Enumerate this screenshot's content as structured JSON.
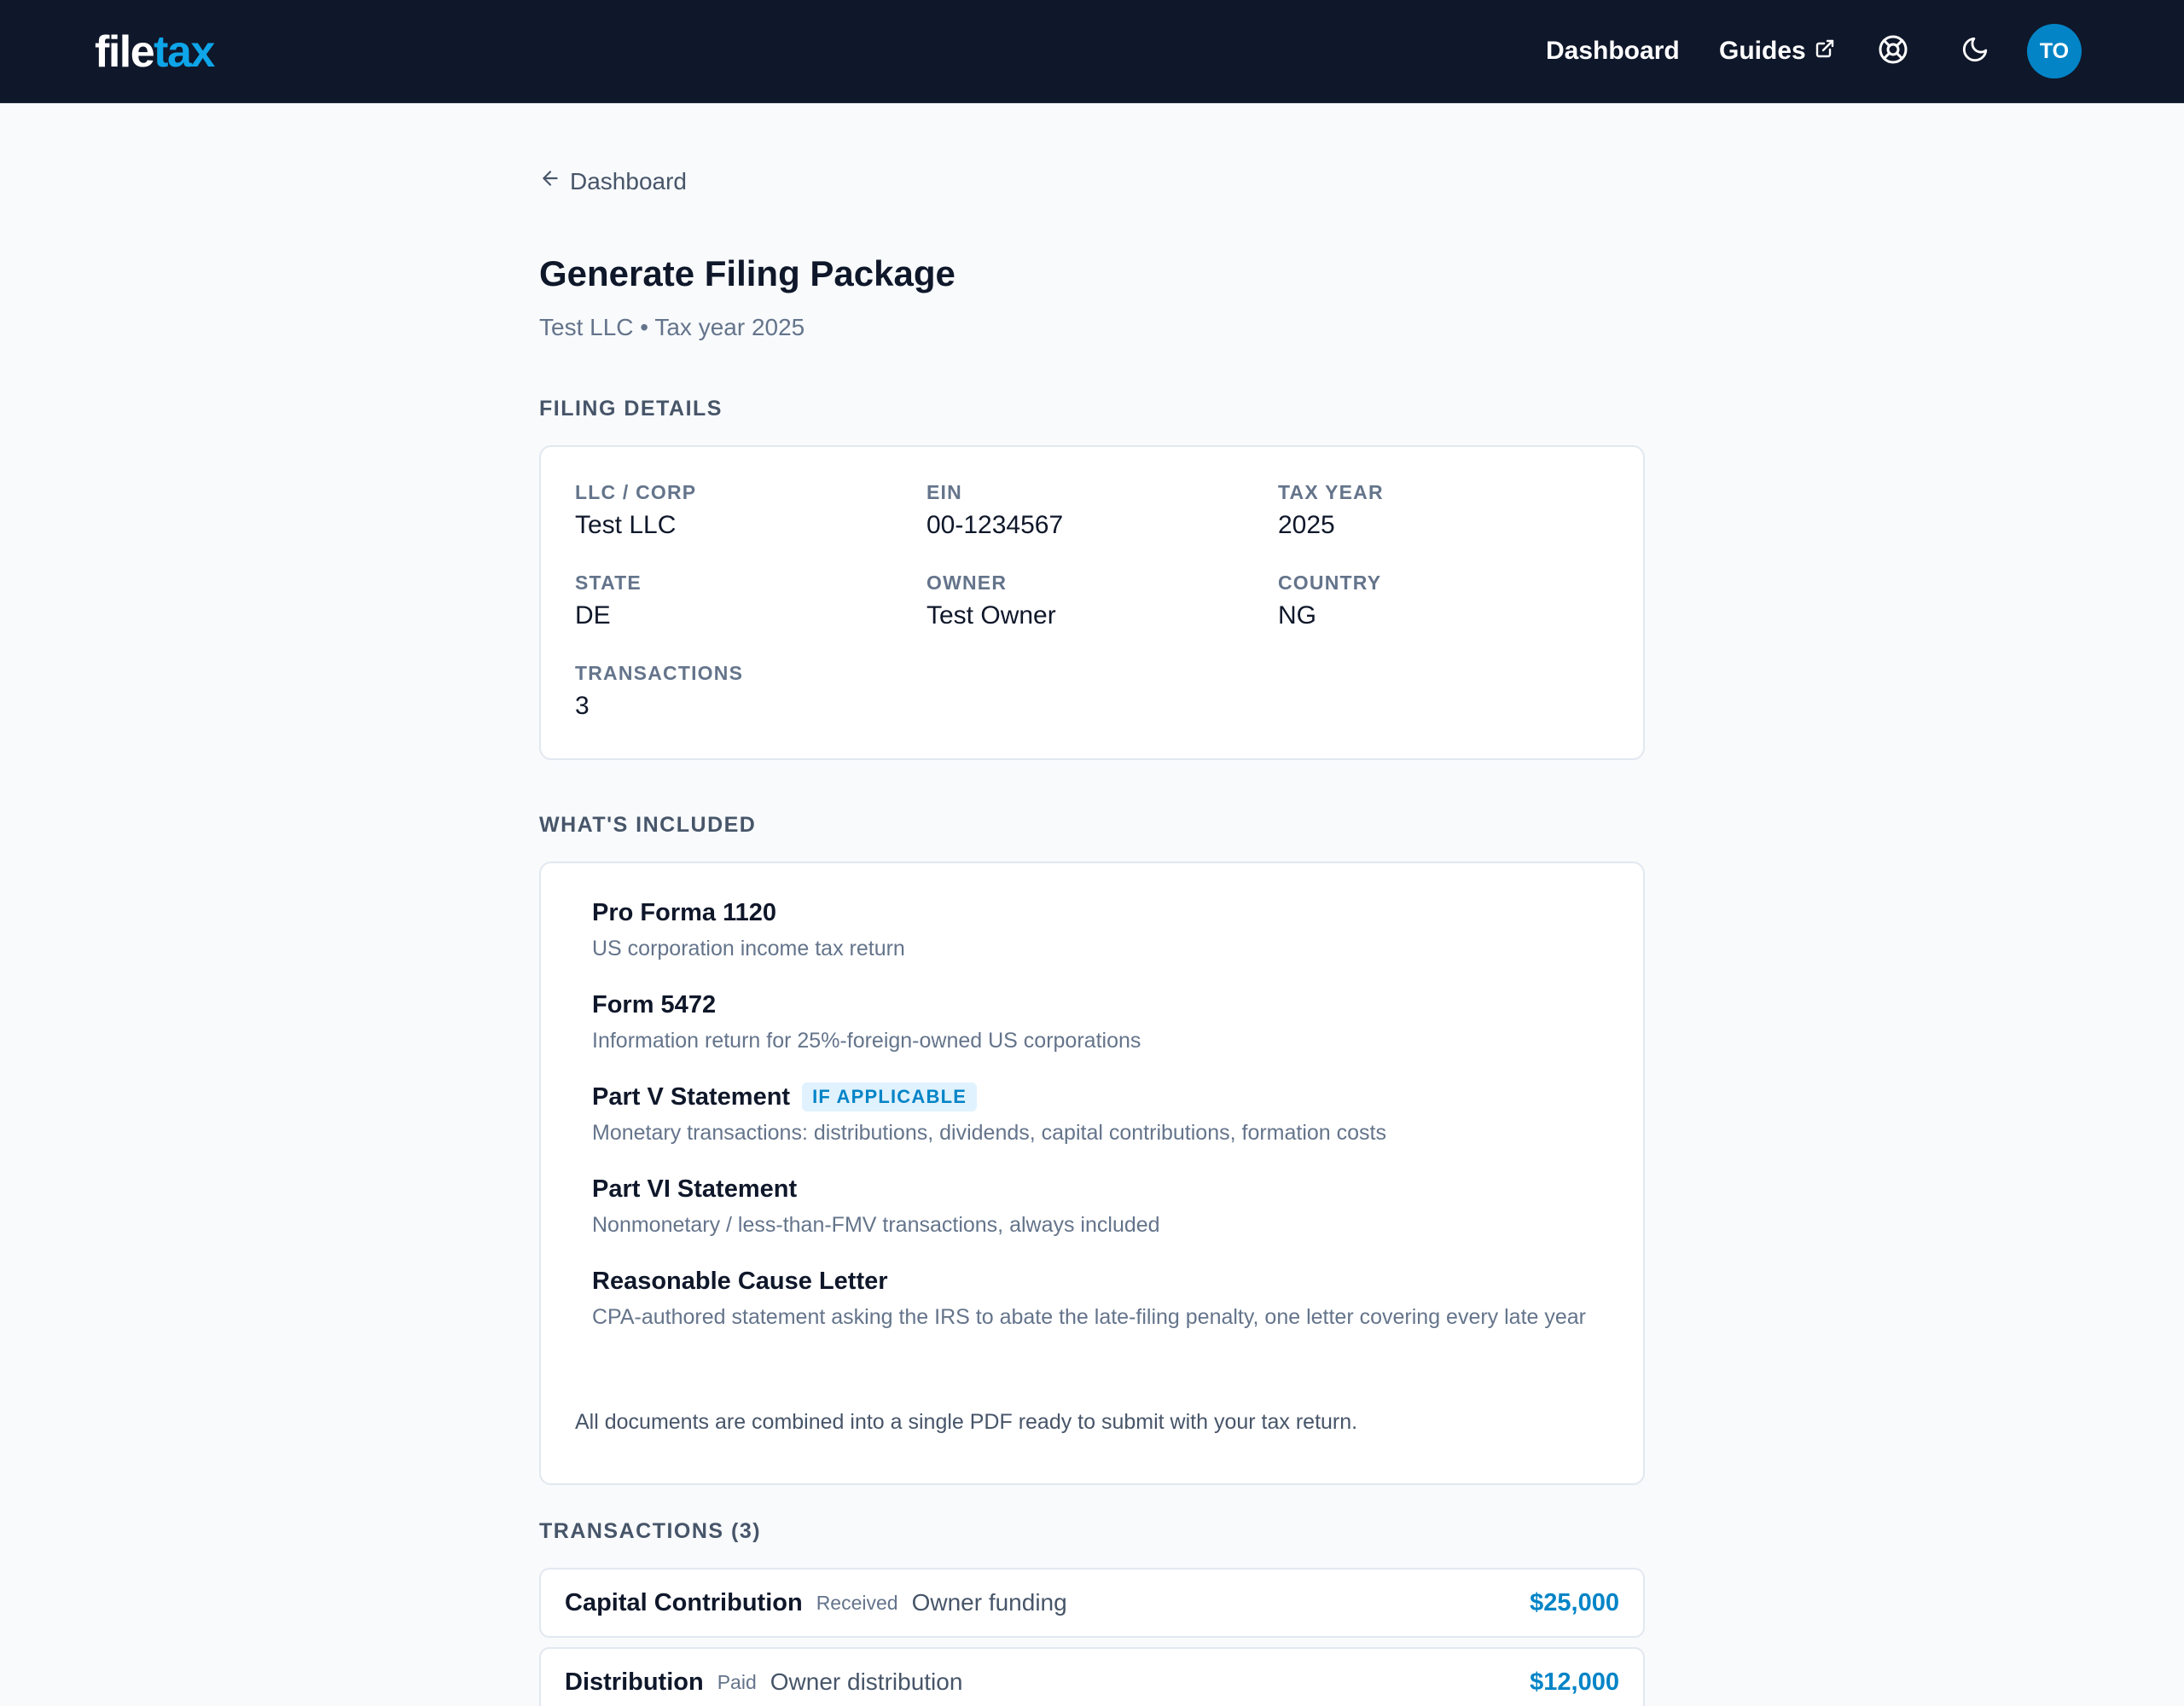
{
  "header": {
    "logo_part1": "file",
    "logo_part2": "tax",
    "nav_dashboard": "Dashboard",
    "nav_guides": "Guides",
    "avatar_initials": "TO",
    "icons": [
      "external-link-icon",
      "help-lifebuoy-icon",
      "moon-icon"
    ]
  },
  "page": {
    "back_label": "Dashboard",
    "title": "Generate Filing Package",
    "subtitle": "Test LLC • Tax year 2025"
  },
  "filing_details": {
    "section_label": "FILING DETAILS",
    "fields": [
      {
        "label": "LLC / CORP",
        "value": "Test LLC"
      },
      {
        "label": "EIN",
        "value": "00-1234567"
      },
      {
        "label": "TAX YEAR",
        "value": "2025"
      },
      {
        "label": "STATE",
        "value": "DE"
      },
      {
        "label": "OWNER",
        "value": "Test Owner"
      },
      {
        "label": "COUNTRY",
        "value": "NG"
      },
      {
        "label": "TRANSACTIONS",
        "value": "3"
      }
    ]
  },
  "included": {
    "section_label": "WHAT'S INCLUDED",
    "items": [
      {
        "title": "Pro Forma 1120",
        "description": "US corporation income tax return"
      },
      {
        "title": "Form 5472",
        "description": "Information return for 25%-foreign-owned US corporations"
      },
      {
        "title": "Part V Statement",
        "badge": "IF APPLICABLE",
        "description": "Monetary transactions: distributions, dividends, capital contributions, formation costs"
      },
      {
        "title": "Part VI Statement",
        "description": "Nonmonetary / less-than-FMV transactions, always included"
      },
      {
        "title": "Reasonable Cause Letter",
        "description": "CPA-authored statement asking the IRS to abate the late-filing penalty, one letter covering every late year"
      }
    ],
    "note": "All documents are combined into a single PDF ready to submit with your tax return."
  },
  "transactions": {
    "section_label": "TRANSACTIONS (3)",
    "rows": [
      {
        "type": "Capital Contribution",
        "status": "Received",
        "description": "Owner funding",
        "amount": "$25,000"
      },
      {
        "type": "Distribution",
        "status": "Paid",
        "description": "Owner distribution",
        "amount": "$12,000"
      }
    ]
  },
  "colors": {
    "header_bg": "#0f172a",
    "accent": "#0284c7",
    "logo_accent": "#0ea5e9",
    "page_bg": "#f8fafc"
  }
}
